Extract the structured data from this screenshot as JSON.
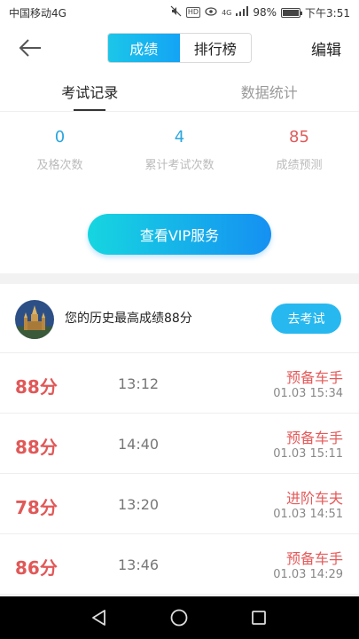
{
  "status_bar": {
    "carrier": "中国移动4G",
    "hd_label": "HD",
    "network_label": "4G",
    "battery_text": "98%",
    "battery_level": 0.98,
    "time": "下午3:51"
  },
  "nav": {
    "segments": [
      "成绩",
      "排行榜"
    ],
    "active_segment": 0,
    "edit_label": "编辑"
  },
  "tabs": {
    "items": [
      "考试记录",
      "数据统计"
    ],
    "active": 0
  },
  "stats": [
    {
      "value": "0",
      "label": "及格次数",
      "color": "#2aa6e0"
    },
    {
      "value": "4",
      "label": "累计考试次数",
      "color": "#2aa6e0"
    },
    {
      "value": "85",
      "label": "成绩预测",
      "color": "#e05a5a"
    }
  ],
  "vip_button": "查看VIP服务",
  "best": {
    "text": "您的历史最高成绩88分",
    "button": "去考试"
  },
  "records": [
    {
      "score": "88分",
      "duration": "13:12",
      "rank": "预备车手",
      "date": "01.03  15:34"
    },
    {
      "score": "88分",
      "duration": "14:40",
      "rank": "预备车手",
      "date": "01.03  15:11"
    },
    {
      "score": "78分",
      "duration": "13:20",
      "rank": "进阶车夫",
      "date": "01.03  14:51"
    },
    {
      "score": "86分",
      "duration": "13:46",
      "rank": "预备车手",
      "date": "01.03  14:29"
    }
  ],
  "colors": {
    "accent": "#1ba8f0",
    "score_red": "#e15858"
  }
}
